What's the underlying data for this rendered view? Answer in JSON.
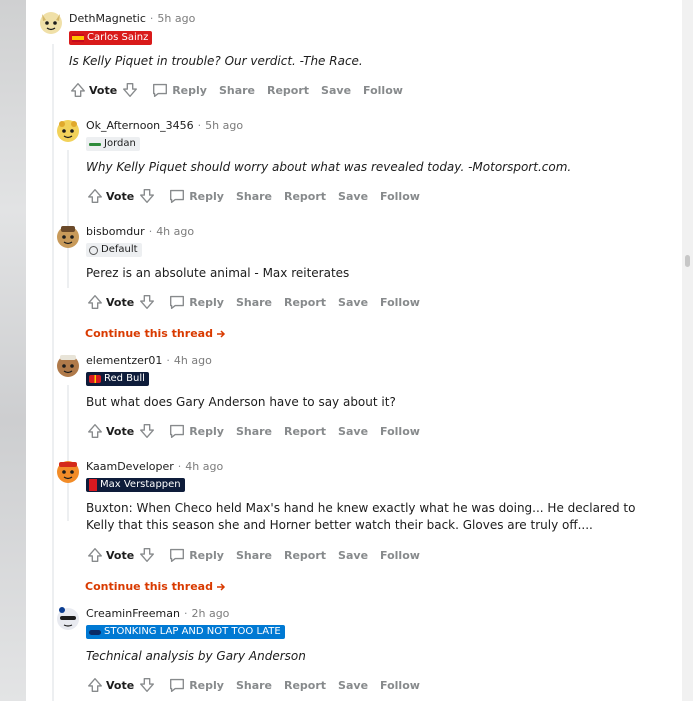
{
  "comments": [
    {
      "user": "DethMagnetic",
      "time": "5h ago",
      "flair": "Carlos Sainz",
      "flair_icon": "spain-flag-icon",
      "flair_bg": "#d91a1a",
      "flair_fg": "#ffffff",
      "text": "Is Kelly Piquet in trouble? Our verdict. -The Race.",
      "italic": true
    },
    {
      "user": "Ok_Afternoon_3456",
      "time": "5h ago",
      "flair": "Jordan",
      "flair_icon": "jordan-car-icon",
      "flair_bg": "#edeff1",
      "flair_fg": "#1c1c1c",
      "text": "Why Kelly Piquet should worry about what was revealed today. -Motorsport.com.",
      "italic": true
    },
    {
      "user": "bisbomdur",
      "time": "4h ago",
      "flair": "Default",
      "flair_icon": "wheel-icon",
      "flair_bg": "#edeff1",
      "flair_fg": "#1c1c1c",
      "text": "Perez is an absolute animal - Max reiterates",
      "italic": false
    },
    {
      "user": "elementzer01",
      "time": "4h ago",
      "flair": "Red Bull",
      "flair_icon": "red-bull-icon",
      "flair_bg": "#0e1c3a",
      "flair_fg": "#ffffff",
      "text": "But what does Gary Anderson have to say about it?",
      "italic": false
    },
    {
      "user": "KaamDeveloper",
      "time": "4h ago",
      "flair": "Max Verstappen",
      "flair_icon": "dutch-flag-icon",
      "flair_bg": "#0e1c3a",
      "flair_fg": "#ffffff",
      "text": "Buxton: When Checo held Max's hand he knew exactly what he was doing... He declared to Kelly that this season she and Horner better watch their back. Gloves are truly off....",
      "italic": false
    },
    {
      "user": "CreaminFreeman",
      "time": "2h ago",
      "flair": "STONKING LAP AND NOT TOO LATE",
      "flair_icon": "car-icon",
      "flair_bg": "#0079d3",
      "flair_fg": "#ffffff",
      "text": "Technical analysis by Gary Anderson",
      "italic": true
    }
  ],
  "actions": {
    "vote": "Vote",
    "reply": "Reply",
    "share": "Share",
    "report": "Report",
    "save": "Save",
    "follow": "Follow"
  },
  "continue_label": "Continue this thread",
  "colors": {
    "accent": "#d93a00",
    "muted": "#878a8c",
    "thread_line": "#edeff1"
  }
}
